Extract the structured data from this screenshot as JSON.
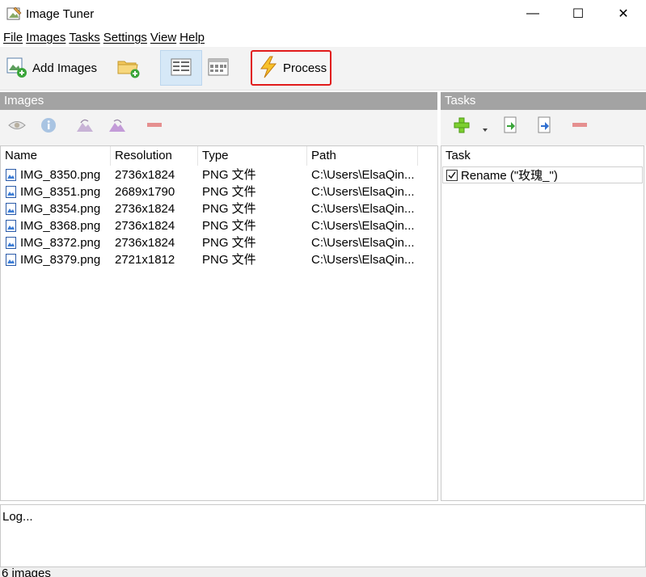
{
  "window": {
    "title": "Image Tuner",
    "minimize_glyph": "—",
    "maximize_glyph": "☐",
    "close_glyph": "✕"
  },
  "menu": {
    "items": [
      "File",
      "Images",
      "Tasks",
      "Settings",
      "View",
      "Help"
    ]
  },
  "toolbar": {
    "add_images_label": "Add Images",
    "process_label": "Process",
    "process_highlight_color": "#e11b1b",
    "icons": [
      "add-images-icon",
      "add-folder-icon",
      "details-view-icon",
      "thumbnail-view-icon",
      "lightning-icon"
    ]
  },
  "images_panel": {
    "header": "Images",
    "tools": [
      "eye-icon",
      "info-icon",
      "rotate-left-icon",
      "rotate-right-icon",
      "remove-icon"
    ],
    "columns": [
      "Name",
      "Resolution",
      "Type",
      "Path"
    ],
    "rows": [
      {
        "name": "IMG_8350.png",
        "resolution": "2736x1824",
        "type": "PNG 文件",
        "path": "C:\\Users\\ElsaQin..."
      },
      {
        "name": "IMG_8351.png",
        "resolution": "2689x1790",
        "type": "PNG 文件",
        "path": "C:\\Users\\ElsaQin..."
      },
      {
        "name": "IMG_8354.png",
        "resolution": "2736x1824",
        "type": "PNG 文件",
        "path": "C:\\Users\\ElsaQin..."
      },
      {
        "name": "IMG_8368.png",
        "resolution": "2736x1824",
        "type": "PNG 文件",
        "path": "C:\\Users\\ElsaQin..."
      },
      {
        "name": "IMG_8372.png",
        "resolution": "2736x1824",
        "type": "PNG 文件",
        "path": "C:\\Users\\ElsaQin..."
      },
      {
        "name": "IMG_8379.png",
        "resolution": "2721x1812",
        "type": "PNG 文件",
        "path": "C:\\Users\\ElsaQin..."
      }
    ]
  },
  "tasks_panel": {
    "header": "Tasks",
    "tools": [
      "add-task-icon",
      "dropdown-arrow-icon",
      "move-up-icon",
      "move-down-icon",
      "remove-task-icon"
    ],
    "column": "Task",
    "tasks": [
      {
        "label": "Rename (\"玫瑰_\")",
        "checked": true
      }
    ]
  },
  "log": {
    "text": "Log..."
  },
  "status": {
    "text": "6 images"
  }
}
